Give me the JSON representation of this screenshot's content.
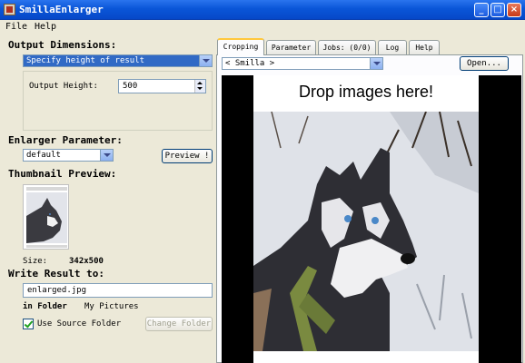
{
  "window": {
    "title": "SmillaEnlarger"
  },
  "menu": {
    "file": "File",
    "help": "Help"
  },
  "left": {
    "output_dimensions_title": "Output Dimensions:",
    "dimension_mode": "Specify height of result",
    "output_height_label": "Output Height:",
    "output_height_value": "500",
    "enlarger_parameter_title": "Enlarger Parameter:",
    "enlarger_preset": "default",
    "preview_button": "Preview !",
    "thumbnail_title": "Thumbnail Preview:",
    "size_label": "Size:",
    "size_value": "342x500",
    "write_result_title": "Write Result to:",
    "output_filename": "enlarged.jpg",
    "in_folder_label": "in Folder",
    "folder_value": "My Pictures",
    "use_source_folder_label": "Use Source Folder",
    "use_source_folder_checked": true,
    "change_folder_button": "Change Folder"
  },
  "tabs": [
    {
      "label": "Cropping"
    },
    {
      "label": "Parameter"
    },
    {
      "label": "Jobs: (0/0)"
    },
    {
      "label": "Log"
    },
    {
      "label": "Help"
    }
  ],
  "right": {
    "source_combo": "< Smilla >",
    "open_button": "Open...",
    "drop_text": "Drop images here!"
  },
  "colors": {
    "titlebar": "#0a56d8",
    "window_bg": "#ece9d8",
    "selection": "#316ac5",
    "active_tab_highlight": "#ffc83c"
  }
}
